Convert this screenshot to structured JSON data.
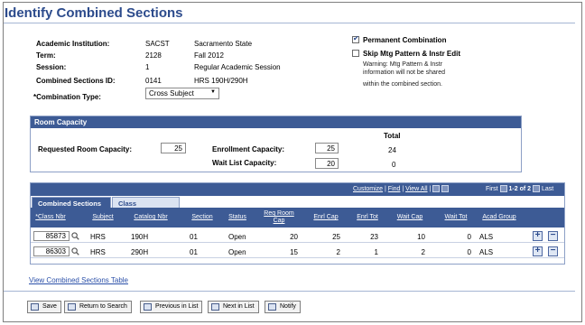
{
  "page": {
    "title": "Identify Combined Sections"
  },
  "fields": {
    "institution": {
      "label": "Academic Institution:",
      "code": "SACST",
      "desc": "Sacramento State"
    },
    "term": {
      "label": "Term:",
      "code": "2128",
      "desc": "Fall 2012"
    },
    "session": {
      "label": "Session:",
      "code": "1",
      "desc": "Regular Academic Session"
    },
    "combined_id": {
      "label": "Combined Sections ID:",
      "code": "0141",
      "desc": "HRS 190H/290H"
    },
    "combination_type": {
      "label": "*Combination Type:",
      "value": "Cross Subject"
    }
  },
  "options": {
    "permanent": {
      "label": "Permanent Combination",
      "checked": true
    },
    "skip_mtg": {
      "label": "Skip Mtg Pattern & Instr Edit",
      "checked": false
    },
    "warning_line1": "Warning: Mtg Pattern & Instr",
    "warning_line2": "information will not be shared",
    "warning_line3": "within the combined section."
  },
  "room_capacity": {
    "header": "Room Capacity",
    "requested_label": "Requested Room Capacity:",
    "requested_value": "25",
    "total_label": "Total",
    "enrollment_label": "Enrollment Capacity:",
    "enrollment_value": "25",
    "enrollment_total": "24",
    "waitlist_label": "Wait List Capacity:",
    "waitlist_value": "20",
    "waitlist_total": "0"
  },
  "grid": {
    "nav": {
      "customize": "Customize",
      "find": "Find",
      "view_all": "View All",
      "first": "First",
      "range": "1-2 of 2",
      "last": "Last"
    },
    "tabs": [
      "Combined Sections",
      "Class Description"
    ],
    "columns": [
      "*Class Nbr",
      "Subject",
      "Catalog Nbr",
      "Section",
      "Status",
      "Req Room Cap",
      "Enrl Cap",
      "Enrl Tot",
      "Wait Cap",
      "Wait Tot",
      "Acad Group"
    ],
    "rows": [
      {
        "class_nbr": "85873",
        "subject": "HRS",
        "catalog": "190H",
        "section": "01",
        "status": "Open",
        "req_room_cap": "20",
        "enrl_cap": "25",
        "enrl_tot": "23",
        "wait_cap": "10",
        "wait_tot": "0",
        "acad_group": "ALS"
      },
      {
        "class_nbr": "86303",
        "subject": "HRS",
        "catalog": "290H",
        "section": "01",
        "status": "Open",
        "req_room_cap": "15",
        "enrl_cap": "2",
        "enrl_tot": "1",
        "wait_cap": "2",
        "wait_tot": "0",
        "acad_group": "ALS"
      }
    ]
  },
  "links": {
    "view_table": "View Combined Sections Table"
  },
  "toolbar": {
    "save": "Save",
    "return": "Return to Search",
    "previous": "Previous in List",
    "next": "Next in List",
    "notify": "Notify"
  },
  "colors": {
    "header_blue": "#3d5b95",
    "title_blue": "#2c4b8c"
  },
  "icons": {
    "lookup": "magnifier-icon",
    "add_row": "plus-icon",
    "delete_row": "minus-icon"
  }
}
